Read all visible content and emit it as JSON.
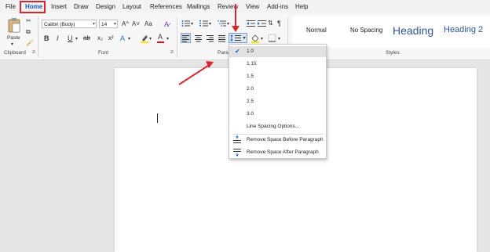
{
  "menu": {
    "items": [
      "File",
      "Home",
      "Insert",
      "Draw",
      "Design",
      "Layout",
      "References",
      "Mailings",
      "Review",
      "View",
      "Add-ins",
      "Help"
    ],
    "active": "Home"
  },
  "clipboard": {
    "paste_label": "Paste",
    "group_label": "Clipboard"
  },
  "font": {
    "name": "Calibri (Body)",
    "size": "14",
    "group_label": "Font",
    "grow": "A^",
    "shrink": "A˅",
    "case": "Aa",
    "bold": "B",
    "italic": "I",
    "underline": "U",
    "strike": "ab",
    "sub": "x₂",
    "sup": "x²"
  },
  "paragraph": {
    "group_label": "Parag"
  },
  "styles": {
    "group_label": "Styles",
    "normal": "Normal",
    "no_spacing": "No Spacing",
    "heading1": "Heading",
    "heading2": "Heading 2"
  },
  "line_spacing_menu": {
    "options": [
      "1.0",
      "1.15",
      "1.5",
      "2.0",
      "2.5",
      "3.0"
    ],
    "selected": "1.0",
    "more": "Line Spacing Options...",
    "remove_before": "Remove Space Before Paragraph",
    "remove_after": "Remove Space After Paragraph"
  },
  "colors": {
    "accent": "#185abd",
    "annotation": "#d9262e",
    "highlight": "#ffe800",
    "font_color": "#e0101b"
  }
}
